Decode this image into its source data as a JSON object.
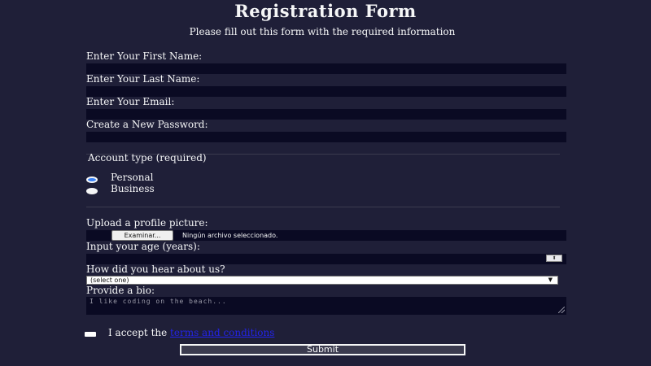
{
  "header": {
    "title": "Registration Form",
    "subtitle": "Please fill out this form with the required information"
  },
  "fields": {
    "first_name_label": "Enter Your First Name:",
    "last_name_label": "Enter Your Last Name:",
    "email_label": "Enter Your Email:",
    "password_label": "Create a New Password:"
  },
  "account": {
    "legend": "Account type (required)",
    "options": [
      {
        "label": "Personal",
        "checked": true
      },
      {
        "label": "Business",
        "checked": false
      }
    ]
  },
  "profile": {
    "upload_label": "Upload a profile picture:",
    "file_button": "Examinar...",
    "file_status": "Ningún archivo seleccionado.",
    "age_label": "Input your age (years):",
    "referrer_label": "How did you hear about us?",
    "referrer_selected": "(select one)",
    "bio_label": "Provide a bio:",
    "bio_placeholder": "I like coding on the beach..."
  },
  "terms": {
    "prefix": "I accept the ",
    "link_text": "terms and conditions"
  },
  "submit_label": "Submit",
  "colors": {
    "background": "#1f1f38",
    "text": "#f5f6f7",
    "input_bg": "#0a0a23",
    "divider": "#3b3b4f",
    "link": "#2323e8",
    "radio_selected": "#3b82f6"
  },
  "icons": {
    "select_arrow": "chevron-down-icon",
    "number_spinner": "spinner-icon",
    "textarea_resize": "resize-handle-icon"
  }
}
